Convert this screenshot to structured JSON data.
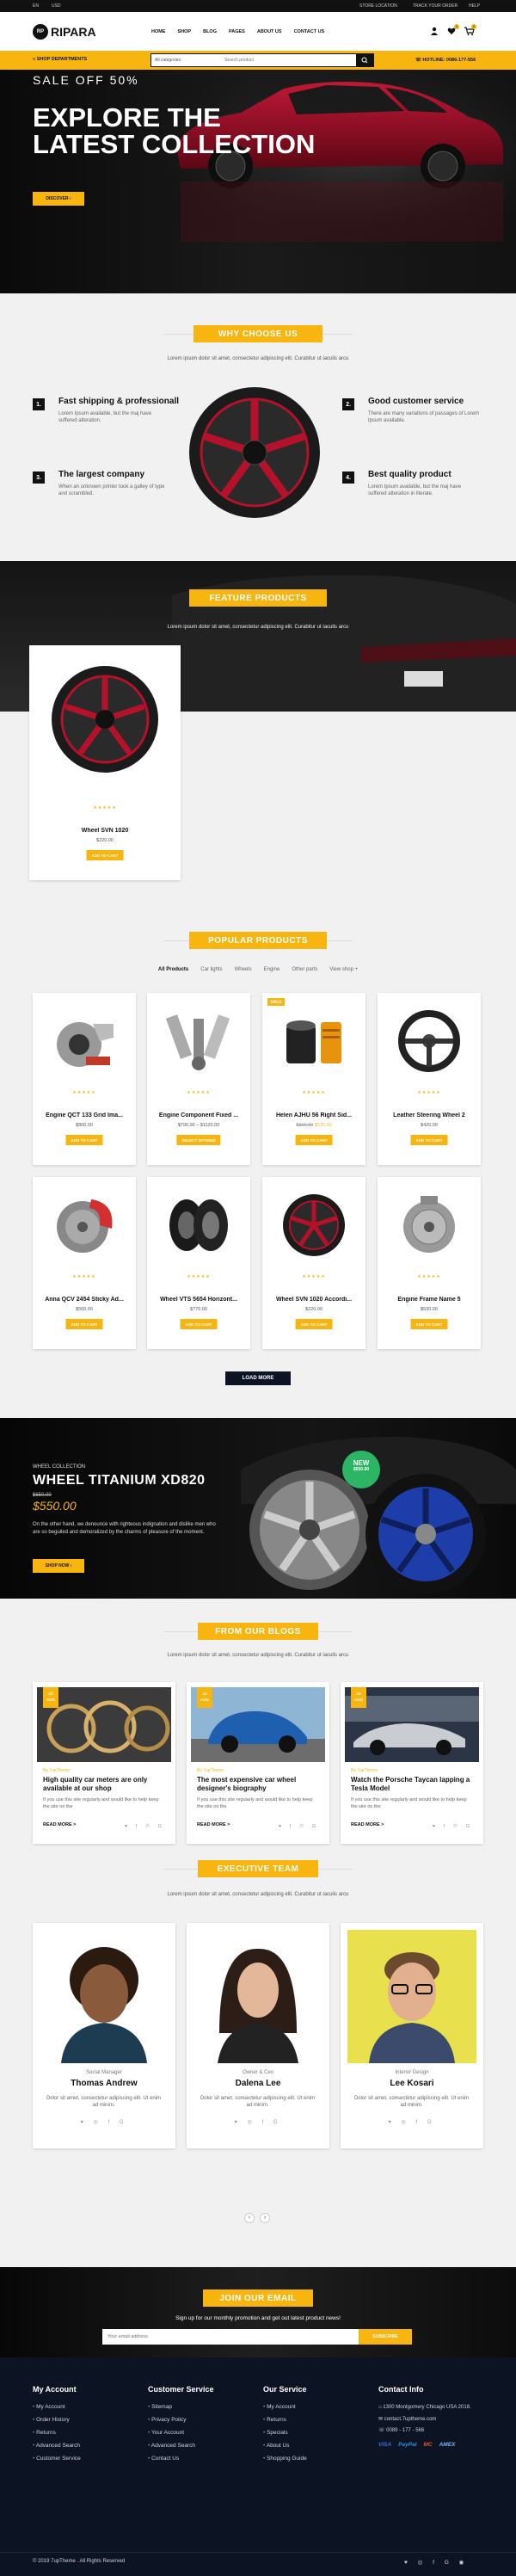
{
  "topbar": {
    "lang": "EN",
    "currency": "USD",
    "store": "STORE LOCATION",
    "track": "TRACK YOUR ORDER",
    "help": "HELP"
  },
  "header": {
    "logo": "RIPARA",
    "logo_mark": "RP",
    "nav": [
      "HOME",
      "SHOP",
      "BLOG",
      "PAGES",
      "ABOUT US",
      "CONTACT US"
    ],
    "wishlist_count": "0",
    "cart_count": "0"
  },
  "catbar": {
    "shop_departments": "SHOP DEPARTMENTS",
    "search_category": "All categories",
    "search_placeholder": "Search product",
    "hotline": "HOTLINE: 0086-177-556"
  },
  "hero": {
    "sale": "SALE OFF 50%",
    "title": "EXPLORE THE LATEST COLLECTION",
    "button": "DISCOVER"
  },
  "why": {
    "title": "WHY CHOOSE US",
    "subtitle": "Lorem ipsum dolor sit amet, consectetur adipiscing elit. Curabitur ut iaculis arcu",
    "features": [
      {
        "num": "1.",
        "title": "Fast shipping & professionall",
        "desc": "Lorem Ipsum available, but the maj have suffered alteration."
      },
      {
        "num": "2.",
        "title": "Good customer service",
        "desc": "There are many variations of passages of Lorem Ipsum available."
      },
      {
        "num": "3.",
        "title": "The largest company",
        "desc": "When an unknown printer took a galley of type and scrambled."
      },
      {
        "num": "4.",
        "title": "Best quality product",
        "desc": "Lorem Ipsum available, but the maj have suffered alteration in literate."
      }
    ]
  },
  "featured": {
    "title": "FEATURE PRODUCTS",
    "subtitle": "Lorem ipsum dolor sit amet, consectetur adipiscing elit. Curabitur ut iaculis arcu",
    "product": {
      "name": "Wheel SVN 1020",
      "price": "$220.00",
      "button": "ADD TO CART"
    }
  },
  "popular": {
    "title": "POPULAR PRODUCTS",
    "tabs": [
      "All Products",
      "Car lights",
      "Wheels",
      "Engine",
      "Other parts",
      "View shop +"
    ],
    "products": [
      {
        "name": "Engine QCT 133 Grid Ima...",
        "old": "",
        "price": "$800.00",
        "button": "ADD TO CART",
        "sale": ""
      },
      {
        "name": "Engine Component Fixed ...",
        "old": "",
        "price": "$790.00 – $1120.00",
        "button": "SELECT OPTIONS",
        "sale": ""
      },
      {
        "name": "Helen AJHU 56 Right Sid...",
        "old": "$800.00",
        "price": "$575.00",
        "button": "ADD TO CART",
        "sale": "SALE"
      },
      {
        "name": "Leather Steering Wheel 2",
        "old": "",
        "price": "$420.00",
        "button": "ADD TO CART",
        "sale": ""
      },
      {
        "name": "Anna QCV 2454 Sticky Ad...",
        "old": "",
        "price": "$500.00",
        "button": "ADD TO CART",
        "sale": ""
      },
      {
        "name": "Wheel VTS 5654 Horizont...",
        "old": "",
        "price": "$770.00",
        "button": "ADD TO CART",
        "sale": ""
      },
      {
        "name": "Wheel SVN 1020 Accordi...",
        "old": "",
        "price": "$220.00",
        "button": "ADD TO CART",
        "sale": ""
      },
      {
        "name": "Engine Frame Name 5",
        "old": "",
        "price": "$530.00",
        "button": "ADD TO CART",
        "sale": ""
      }
    ],
    "load_more": "LOAD MORE"
  },
  "promo": {
    "kicker": "WHEEL COLLECTION",
    "title": "WHEEL TITANIUM XD820",
    "old_price": "$650.00",
    "price": "$550.00",
    "desc": "On the other hand, we denounce with righteous indignation and dislike men who are so beguiled and demoralized by the charms of pleasure of the moment.",
    "button": "SHOP NOW",
    "new_badge": "NEW",
    "new_price": "$550.00"
  },
  "blogs": {
    "title": "FROM OUR BLOGS",
    "subtitle": "Lorem ipsum dolor sit amet, consectetur adipiscing elit. Curabitur ut iaculis arcu",
    "posts": [
      {
        "day": "23",
        "month": "AUG",
        "by": "By 7upTheme",
        "title": "High quality car meters are only available at our shop",
        "desc": "If you use this site regularly and would like to help keep the site on the",
        "read": "READ MORE >",
        "social": "♥ f ⓟ G"
      },
      {
        "day": "23",
        "month": "AUG",
        "by": "By 7upTheme",
        "title": "The most expensive car wheel designer's biography",
        "desc": "If you use this site regularly and would like to help keep the site on the",
        "read": "READ MORE >",
        "social": "♥ f ⓟ G"
      },
      {
        "day": "23",
        "month": "AUG",
        "by": "By 7upTheme",
        "title": "Watch the Porsche Taycan lapping a Tesla Model",
        "desc": "If you use this site regularly and would like to help keep the site on the",
        "read": "READ MORE >",
        "social": "♥ f ⓟ G"
      }
    ]
  },
  "team": {
    "title": "EXECUTIVE TEAM",
    "subtitle": "Lorem ipsum dolor sit amet, consectetur adipiscing elit. Curabitur ut iaculis arcu",
    "members": [
      {
        "role": "Social Manager",
        "name": "Thomas Andrew",
        "desc": "Dolor sit amet, consectetur adipiscing elit. Ut enim ad minim.",
        "social": "♥ ◎ f G"
      },
      {
        "role": "Owner & Ceo",
        "name": "Dalena Lee",
        "desc": "Dolor sit amet, consectetur adipiscing elit. Ut enim ad minim.",
        "social": "♥ ◎ f G"
      },
      {
        "role": "Interior Design",
        "name": "Lee Kosari",
        "desc": "Dolor sit amet, consectetur adipiscing elit. Ut enim ad minim.",
        "social": "♥ ◎ f G"
      }
    ]
  },
  "newsletter": {
    "title": "JOIN OUR EMAIL",
    "desc": "Sign up for our monthly promotion and get out latest product news!",
    "placeholder": "Your email address",
    "button": "SUBSCRIBE"
  },
  "footer": {
    "cols": [
      {
        "title": "My Account",
        "items": [
          "My Account",
          "Order History",
          "Returns",
          "Advanced Search",
          "Customer Service"
        ]
      },
      {
        "title": "Customer Service",
        "items": [
          "Sitemap",
          "Privacy Policy",
          "Your Account",
          "Advanced Search",
          "Contact Us"
        ]
      },
      {
        "title": "Our Service",
        "items": [
          "My Account",
          "Returns",
          "Specials",
          "About Us",
          "Shopping Guide"
        ]
      }
    ],
    "contact_title": "Contact Info",
    "address": "1300 Montgomery Chicago USA 2018.",
    "email": "contact.7uptheme.com",
    "phone": "0089 - 177 - 566",
    "payments": [
      "VISA",
      "PayPal",
      "MC",
      "AMEX"
    ],
    "copyright": "© 2019 7upTheme . All Rights Reserved",
    "social": "♥ ◎ f G ◉"
  },
  "colors": {
    "accent": "#f9b50f",
    "dark": "#111111",
    "footer": "#0c1424"
  }
}
